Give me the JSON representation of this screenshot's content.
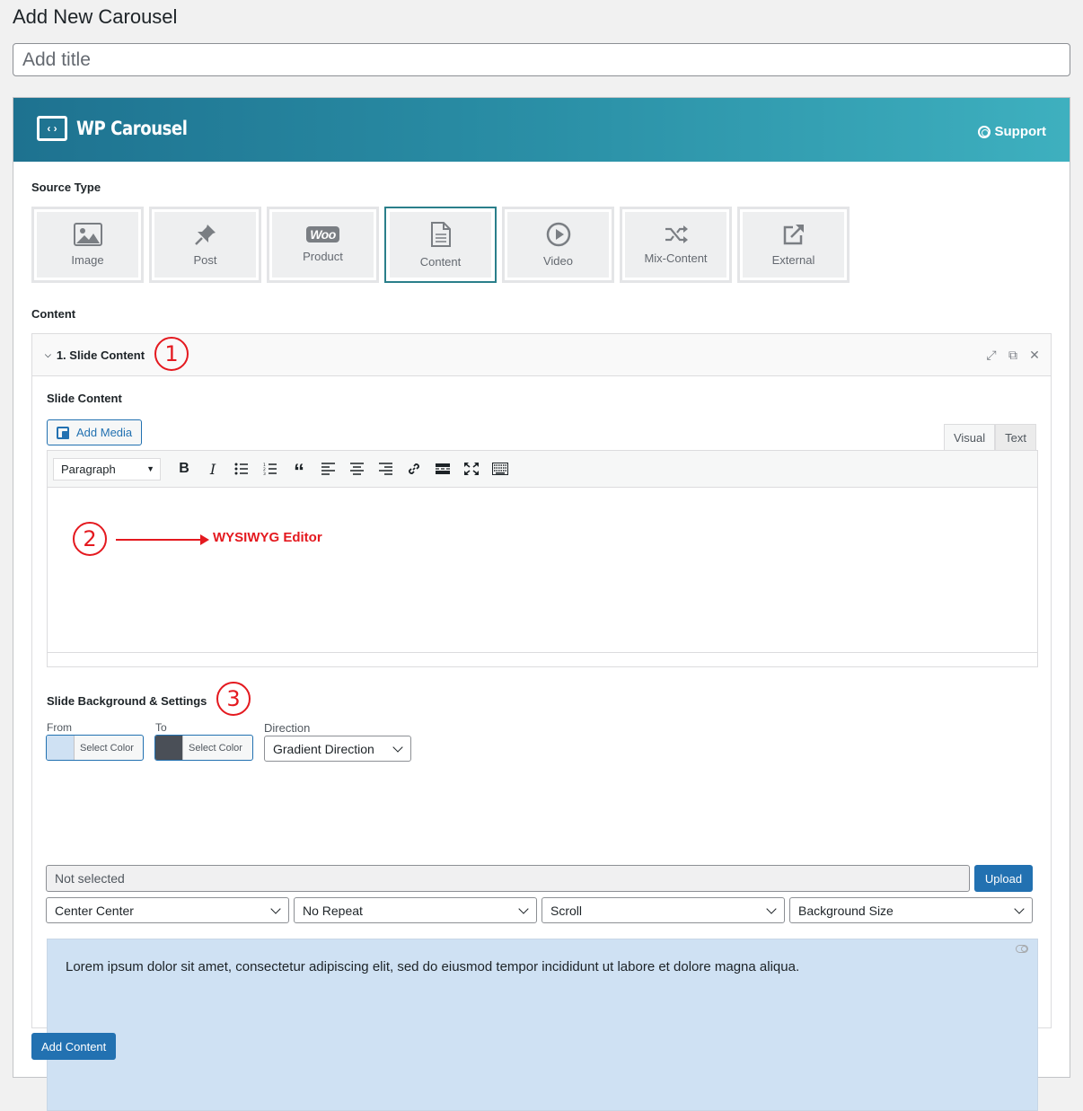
{
  "page": {
    "title": "Add New Carousel"
  },
  "title_field": {
    "placeholder": "Add title",
    "value": ""
  },
  "header": {
    "brand": "WP Carousel",
    "support": "Support"
  },
  "source_type": {
    "label": "Source Type",
    "options": [
      {
        "label": "Image",
        "icon": "image-icon",
        "active": false
      },
      {
        "label": "Post",
        "icon": "pin-icon",
        "active": false
      },
      {
        "label": "Product",
        "icon": "woo-icon",
        "active": false
      },
      {
        "label": "Content",
        "icon": "document-icon",
        "active": true
      },
      {
        "label": "Video",
        "icon": "play-icon",
        "active": false
      },
      {
        "label": "Mix-Content",
        "icon": "shuffle-icon",
        "active": false
      },
      {
        "label": "External",
        "icon": "external-link-icon",
        "active": false
      }
    ],
    "woo_text": "Woo"
  },
  "content": {
    "label": "Content",
    "group_title": "1. Slide Content",
    "annotations": {
      "one": "1",
      "two": "2",
      "three": "3",
      "wysiwyg": "WYSIWYG Editor"
    },
    "slide_content_label": "Slide Content",
    "add_media": "Add Media",
    "tabs": {
      "visual": "Visual",
      "text": "Text"
    },
    "format_select": "Paragraph",
    "toolbar_icons": [
      "bold-icon",
      "italic-icon",
      "bullet-list-icon",
      "numbered-list-icon",
      "blockquote-icon",
      "align-left-icon",
      "align-center-icon",
      "align-right-icon",
      "link-icon",
      "read-more-icon",
      "fullscreen-icon",
      "toolbar-toggle-icon"
    ],
    "background": {
      "label": "Slide Background & Settings",
      "from_label": "From",
      "to_label": "To",
      "direction_label": "Direction",
      "from_button": "Select Color",
      "to_button": "Select Color",
      "from_color": "#cfe1f3",
      "to_color": "#4a4f57",
      "direction": "Gradient Direction",
      "image_value": "Not selected",
      "upload": "Upload",
      "position": "Center Center",
      "repeat": "No Repeat",
      "attachment": "Scroll",
      "size": "Background Size"
    },
    "preview_text": "Lorem ipsum dolor sit amet, consectetur adipiscing elit, sed do eiusmod tempor incididunt ut labore et dolore magna aliqua.",
    "add_content": "Add Content"
  },
  "colors": {
    "accent": "#2271b1",
    "header_start": "#1e7290",
    "header_end": "#3eb0bf",
    "annotation": "#e4191f"
  }
}
